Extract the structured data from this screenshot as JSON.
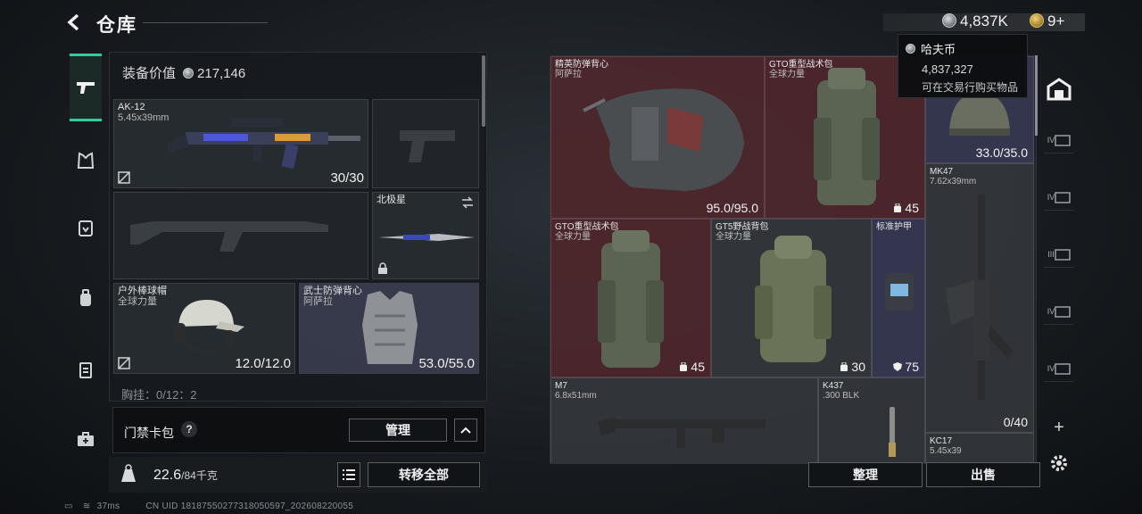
{
  "header": {
    "title": "仓库",
    "currency_silver": "4,837K",
    "currency_gold": "9+"
  },
  "tooltip": {
    "title": "哈夫币",
    "value": "4,837,327",
    "hint": "可在交易行购买物品"
  },
  "loadout": {
    "equip_value_label": "装备价值",
    "equip_value": "217,146",
    "primary": {
      "name": "AK-12",
      "ammo": "5.45x39mm",
      "durability": "30/30"
    },
    "melee": {
      "name": "北极星"
    },
    "helmet": {
      "name": "户外棒球帽",
      "brand": "全球力量",
      "durability": "12.0/12.0"
    },
    "armor": {
      "name": "武士防弹背心",
      "brand": "阿萨拉",
      "durability": "53.0/55.0"
    },
    "partial_label": "胸挂：0/12：2"
  },
  "keycard": {
    "label": "门禁卡包",
    "help": "?",
    "manage_label": "管理"
  },
  "bottom": {
    "weight": "22.6",
    "weight_unit": "/84千克",
    "transfer_all": "转移全部"
  },
  "stash": {
    "items": [
      {
        "name": "精英防弹背心",
        "brand": "阿萨拉",
        "value": "95.0/95.0"
      },
      {
        "name": "GTO重型战术包",
        "brand": "全球力量",
        "value": "45"
      },
      {
        "name": "",
        "brand": "",
        "value": "33.0/35.0"
      },
      {
        "name": "MK47",
        "brand": "7.62x39mm",
        "value": "0/40"
      },
      {
        "name": "GTO重型战术包",
        "brand": "全球力量",
        "value": "45"
      },
      {
        "name": "GT5野战背包",
        "brand": "全球力量",
        "value": "30"
      },
      {
        "name": "标准护甲",
        "brand": "",
        "value": "75"
      },
      {
        "name": "M7",
        "brand": "6.8x51mm",
        "value": ""
      },
      {
        "name": "K437",
        "brand": ".300 BLK",
        "value": ""
      },
      {
        "name": "KC17",
        "brand": "5.45x39",
        "value": ""
      }
    ],
    "sort_label": "整理",
    "sell_label": "出售"
  },
  "right_rail": [
    "IV",
    "IV",
    "III",
    "IV",
    "IV",
    "+"
  ],
  "status_bar": {
    "ping": "37ms",
    "uid": "CN UID 18187550277318050597_202608220055"
  },
  "colors": {
    "accent": "#2ecf9a",
    "rare_red": "#6e282d",
    "rare_purple": "#46466e"
  }
}
